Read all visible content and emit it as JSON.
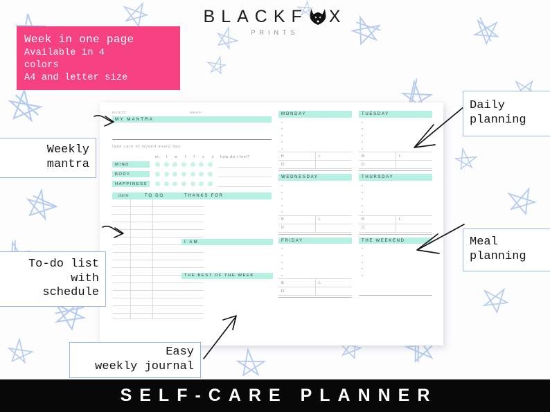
{
  "brand": {
    "name_part1": "BLACKF",
    "name_part2": "X",
    "icon": "fox-head-icon",
    "subtitle": "PRINTS"
  },
  "promo_banner": {
    "line1": "Week in one page",
    "line2": "Available in 4",
    "line3": "colors",
    "line4": "A4 and letter size",
    "background_color": "#f5417f",
    "text_color": "#ffffff"
  },
  "callouts": [
    {
      "id": "weekly-mantra",
      "line1": "Weekly",
      "line2": "mantra"
    },
    {
      "id": "todo-list",
      "line1": "To-do list",
      "line2": "with",
      "line3": "schedule"
    },
    {
      "id": "easy-journal",
      "line1": "Easy",
      "line2": "weekly journal"
    },
    {
      "id": "daily-planning",
      "line1": "Daily",
      "line2": "planning"
    },
    {
      "id": "meal-planning",
      "line1": "Meal",
      "line2": "planning"
    }
  ],
  "planner": {
    "accent_color": "#b5f0e3",
    "header": {
      "month_label": "month:",
      "week_label": "week:"
    },
    "mantra_bar": "MY MANTRA",
    "self_care": {
      "caption": "take care of myself every day",
      "day_initials": [
        "m",
        "t",
        "w",
        "t",
        "f",
        "s",
        "s"
      ],
      "feel_label": "how do i feel?",
      "rows": [
        "MIND",
        "BODY",
        "HAPPINESS"
      ],
      "dots_per_row": 7
    },
    "todo": {
      "col_date": "date",
      "col_todo": "TO DO",
      "col_thanks": "THANKS FOR",
      "ruled_lines": 16
    },
    "i_am_bar": "I AM",
    "best_of_week_bar": "THE BEST OF THE WEEK",
    "days": [
      {
        "name": "MONDAY",
        "tasks": 5,
        "has_meals": true,
        "meals": [
          "B",
          "L",
          "D"
        ]
      },
      {
        "name": "TUESDAY",
        "tasks": 5,
        "has_meals": true,
        "meals": [
          "B",
          "L",
          "D"
        ]
      },
      {
        "name": "WEDNESDAY",
        "tasks": 5,
        "has_meals": true,
        "meals": [
          "B",
          "L",
          "D"
        ]
      },
      {
        "name": "THURSDAY",
        "tasks": 5,
        "has_meals": true,
        "meals": [
          "B",
          "L",
          "D"
        ]
      },
      {
        "name": "FRIDAY",
        "tasks": 5,
        "has_meals": true,
        "meals": [
          "B",
          "L",
          "D"
        ]
      },
      {
        "name": "THE WEEKEND",
        "tasks": 5,
        "has_meals": false,
        "meals": []
      }
    ]
  },
  "footer": {
    "title": "SELF-CARE PLANNER",
    "background_color": "#080808",
    "text_color": "#ffffff"
  },
  "background": {
    "doodle": "star-doodle",
    "doodle_color": "#a9c3ec"
  }
}
